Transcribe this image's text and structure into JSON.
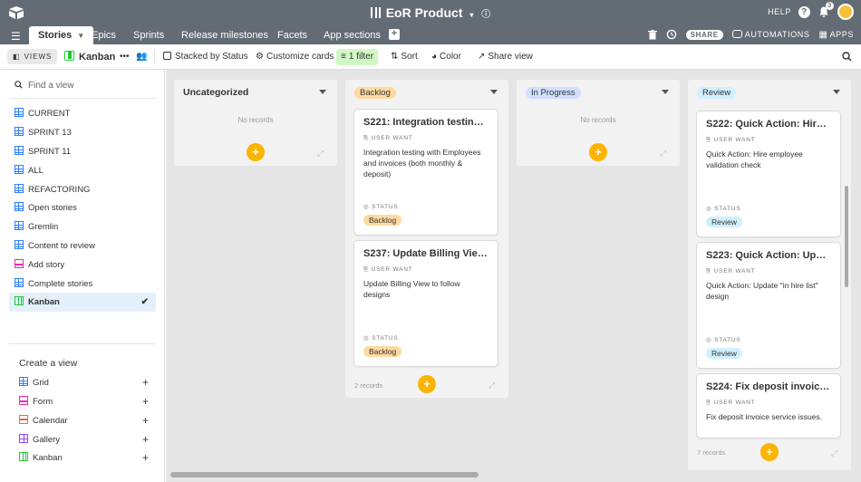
{
  "app": {
    "base_title": "EoR Product",
    "help_label": "HELP",
    "notification_count": "3"
  },
  "tabs": [
    {
      "label": "Stories"
    },
    {
      "label": "Epics"
    },
    {
      "label": "Sprints"
    },
    {
      "label": "Release milestones"
    },
    {
      "label": "Facets"
    },
    {
      "label": "App sections"
    }
  ],
  "tabbar": {
    "share_label": "SHARE",
    "automations_label": "AUTOMATIONS",
    "apps_label": "APPS"
  },
  "toolbar": {
    "views_label": "VIEWS",
    "current_view": "Kanban",
    "stacked_by": "Stacked by Status",
    "customize_cards": "Customize cards",
    "filter": "1 filter",
    "sort": "Sort",
    "color": "Color",
    "share_view": "Share view"
  },
  "sidebar": {
    "find_placeholder": "Find a view",
    "views": [
      {
        "label": "CURRENT",
        "type": "grid"
      },
      {
        "label": "SPRINT 13",
        "type": "grid"
      },
      {
        "label": "SPRINT 11",
        "type": "grid"
      },
      {
        "label": "ALL",
        "type": "grid"
      },
      {
        "label": "REFACTORING",
        "type": "grid"
      },
      {
        "label": "Open stories",
        "type": "grid"
      },
      {
        "label": "Gremlin",
        "type": "grid"
      },
      {
        "label": "Content to review",
        "type": "grid"
      },
      {
        "label": "Add story",
        "type": "form"
      },
      {
        "label": "Complete stories",
        "type": "grid"
      },
      {
        "label": "Kanban",
        "type": "kanban",
        "active": true
      }
    ],
    "create_title": "Create a view",
    "create_items": [
      {
        "label": "Grid"
      },
      {
        "label": "Form"
      },
      {
        "label": "Calendar"
      },
      {
        "label": "Gallery"
      },
      {
        "label": "Kanban"
      }
    ]
  },
  "board": {
    "field_user_want": "USER WANT",
    "field_status": "STATUS",
    "stacks": [
      {
        "name": "Uncategorized",
        "empty_text": "No records",
        "cards": []
      },
      {
        "name": "Backlog",
        "color": "#ffdaa0",
        "record_count": "2 records",
        "cards": [
          {
            "title": "S221: Integration testing ...",
            "user_want": "Integration testing with Employees and invoices (both monthly & deposit)",
            "status": "Backlog"
          },
          {
            "title": "S237: Update Billing View ...",
            "user_want": "Update Billing View to follow designs",
            "status": "Backlog"
          }
        ]
      },
      {
        "name": "In Progress",
        "color": "#cfdfff",
        "empty_text": "No records",
        "cards": []
      },
      {
        "name": "Review",
        "color": "#d0f0fd",
        "record_count": "7 records",
        "cards": [
          {
            "title": "S222: Quick Action: Hire e...",
            "user_want": "Quick Action: Hire employee validation check",
            "status": "Review"
          },
          {
            "title": "S223: Quick Action: Upda...",
            "user_want": "Quick Action: Update \"in hire list\" design",
            "status": "Review"
          },
          {
            "title": "S224: Fix deposit invoice ...",
            "user_want": "Fix deposit invoice service issues."
          }
        ]
      }
    ]
  },
  "colors": {
    "topbar": "#636b74",
    "accent_yellow": "#fcb400",
    "filter_green": "#d1f7c4",
    "active_view": "#e3f0fb"
  }
}
